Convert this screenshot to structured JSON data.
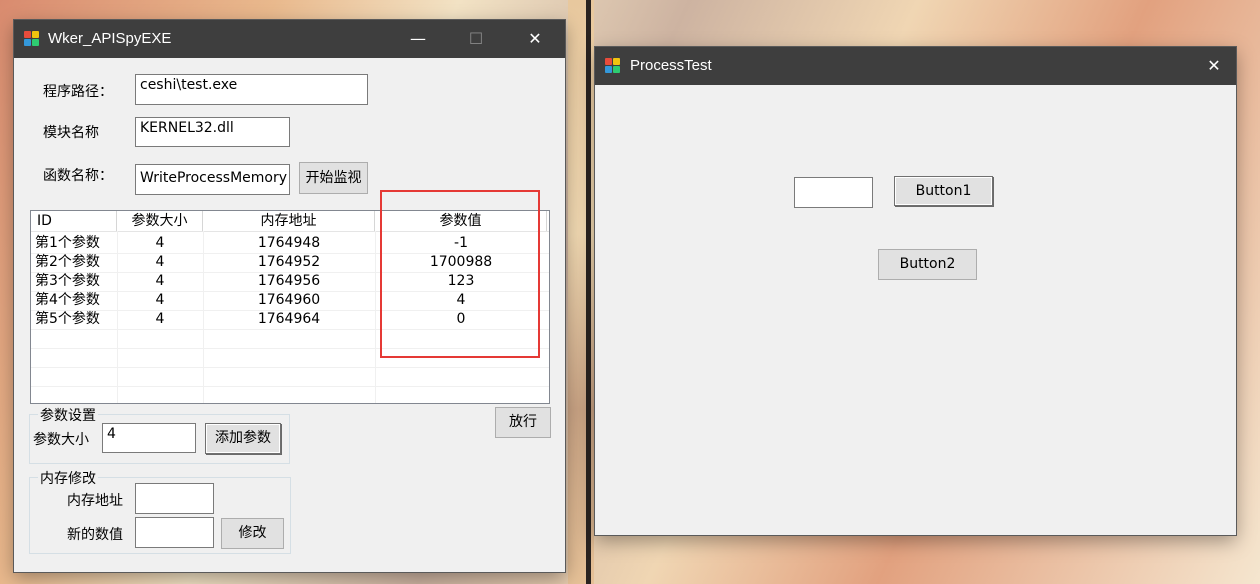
{
  "colors": {
    "titlebar": "#3e3e3e",
    "window_bg": "#f0f0f0",
    "highlight": "#e53935"
  },
  "spy_window": {
    "title": "Wker_APISpyEXE",
    "controls": {
      "minimize": "—",
      "maximize": "☐",
      "close": "✕"
    },
    "program_path_label": "程序路径：",
    "program_path_value": "ceshi\\test.exe",
    "module_label": "模块名称",
    "module_value": "KERNEL32.dll",
    "function_label": "函数名称：",
    "function_value": "WriteProcessMemory",
    "start_monitor_button": "开始监视",
    "table": {
      "columns": [
        "ID",
        "参数大小",
        "内存地址",
        "参数值"
      ],
      "rows": [
        [
          "第1个参数",
          "4",
          "1764948",
          "-1"
        ],
        [
          "第2个参数",
          "4",
          "1764952",
          "1700988"
        ],
        [
          "第3个参数",
          "4",
          "1764956",
          "123"
        ],
        [
          "第4个参数",
          "4",
          "1764960",
          "4"
        ],
        [
          "第5个参数",
          "4",
          "1764964",
          "0"
        ]
      ]
    },
    "release_button": "放行",
    "param_group": {
      "legend": "参数设置",
      "size_label": "参数大小",
      "size_value": "4",
      "add_button": "添加参数"
    },
    "memory_group": {
      "legend": "内存修改",
      "address_label": "内存地址",
      "address_value": "",
      "new_value_label": "新的数值",
      "new_value_value": "",
      "modify_button": "修改"
    }
  },
  "test_window": {
    "title": "ProcessTest",
    "controls": {
      "close": "✕"
    },
    "input_value": "",
    "button1": "Button1",
    "button2": "Button2"
  }
}
